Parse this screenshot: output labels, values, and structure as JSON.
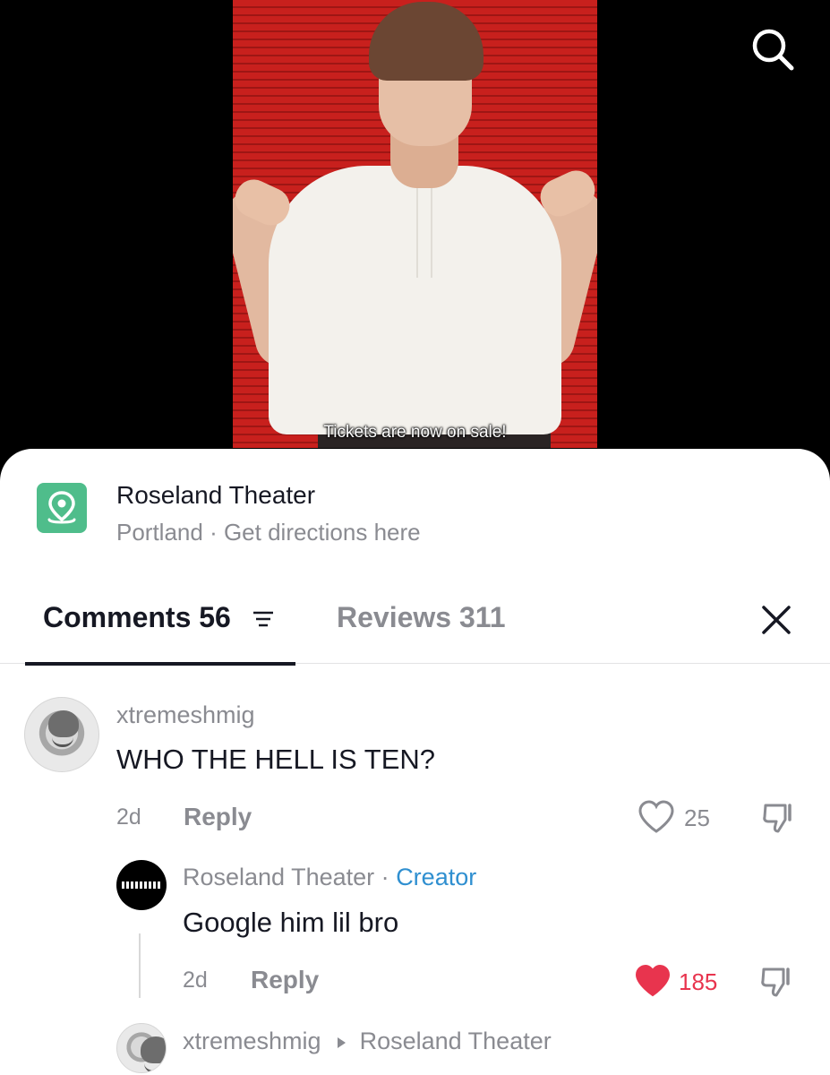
{
  "video": {
    "caption": "Tickets are now on sale!"
  },
  "icons": {
    "search": "search-icon",
    "location": "location-pin-icon",
    "filter": "filter-icon",
    "close": "close-icon",
    "like": "heart-icon",
    "dislike": "thumbs-down-icon",
    "arrow": "triangle-right-icon"
  },
  "colors": {
    "location_badge": "#4fbd8b",
    "creator_tag": "#2f8fd0",
    "liked_heart": "#e8344e"
  },
  "location": {
    "name": "Roseland Theater",
    "subtitle": "Portland · Get directions here"
  },
  "tabs": {
    "comments_label": "Comments 56",
    "reviews_label": "Reviews 311",
    "active": "comments"
  },
  "comments": [
    {
      "username": "xtremeshmig",
      "text": "WHO THE HELL IS TEN?",
      "time": "2d",
      "reply_label": "Reply",
      "likes": "25",
      "liked": false,
      "replies": [
        {
          "username": "Roseland Theater",
          "separator": "·",
          "badge": "Creator",
          "text": "Google him lil bro",
          "time": "2d",
          "reply_label": "Reply",
          "likes": "185",
          "liked": true
        }
      ]
    },
    {
      "username": "xtremeshmig",
      "reply_to": "Roseland Theater"
    }
  ]
}
